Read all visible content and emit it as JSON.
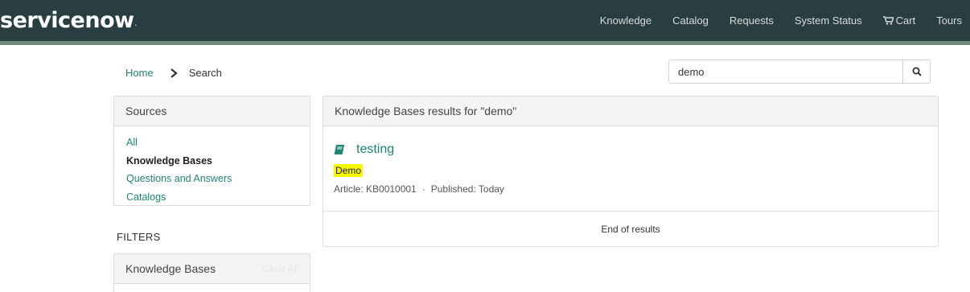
{
  "brand": {
    "logo_text": "servicenow",
    "trademark": "."
  },
  "nav": {
    "items": [
      {
        "label": "Knowledge"
      },
      {
        "label": "Catalog"
      },
      {
        "label": "Requests"
      },
      {
        "label": "System Status"
      },
      {
        "label": "Cart"
      },
      {
        "label": "Tours"
      }
    ]
  },
  "breadcrumb": {
    "home": "Home",
    "current": "Search"
  },
  "search": {
    "value": "demo"
  },
  "sources": {
    "title": "Sources",
    "items": [
      {
        "label": "All"
      },
      {
        "label": "Knowledge Bases"
      },
      {
        "label": "Questions and Answers"
      },
      {
        "label": "Catalogs"
      }
    ]
  },
  "filters": {
    "label": "FILTERS",
    "kb_title": "Knowledge Bases",
    "clear_all": "Clear All"
  },
  "results": {
    "header": "Knowledge Bases results for \"demo\"",
    "items": [
      {
        "title": "testing",
        "badge": "Demo",
        "article": "Article: KB0010001",
        "separator": "·",
        "published": "Published: Today"
      }
    ],
    "end_text": "End of results"
  },
  "colors": {
    "topbar": "#293e40",
    "accent": "#1f8476",
    "highlight": "#f6f600"
  }
}
